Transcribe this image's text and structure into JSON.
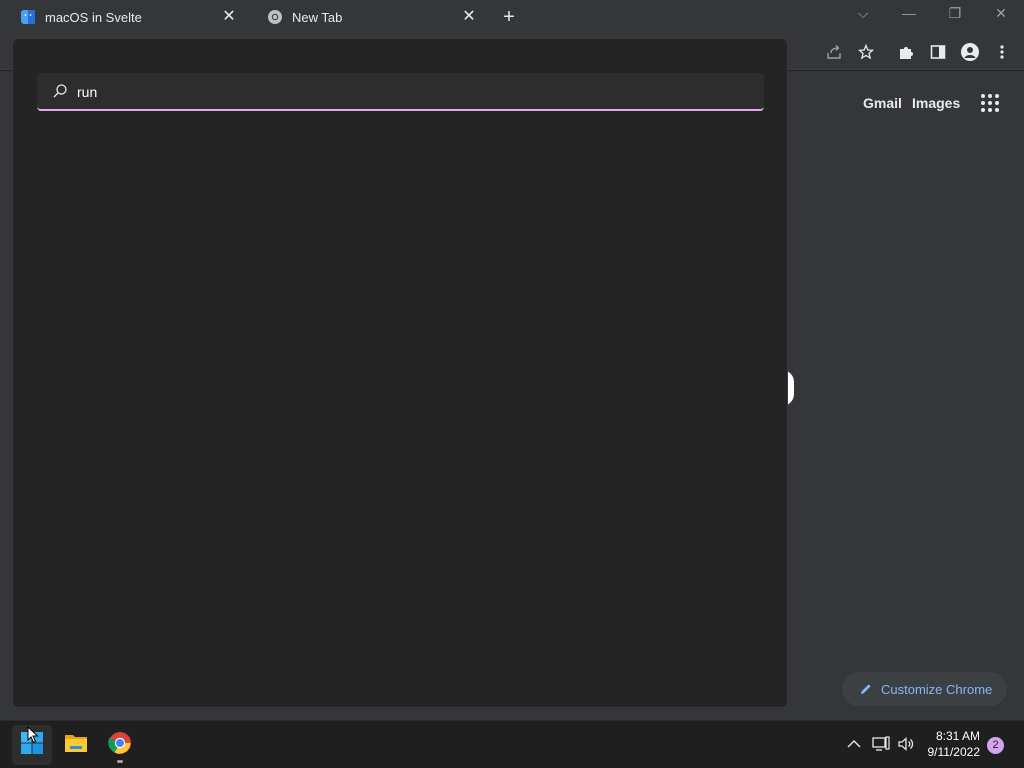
{
  "tabs": [
    {
      "title": "macOS in Svelte",
      "favicon": "finder-favicon-icon"
    },
    {
      "title": "New Tab",
      "favicon": "chrome-favicon-icon"
    }
  ],
  "ntp": {
    "gmail": "Gmail",
    "images": "Images",
    "customize": "Customize Chrome"
  },
  "start_menu": {
    "search_value": "run"
  },
  "taskbar": {
    "time": "8:31 AM",
    "date": "9/11/2022",
    "notification_count": "2",
    "apps": [
      "windows-start-icon",
      "file-explorer-icon",
      "chrome-icon"
    ]
  },
  "colors": {
    "accent": "#e6a6f0",
    "link_blue": "#8ab4f8",
    "panel_bg": "#242424",
    "chrome_bg": "#35363a"
  }
}
